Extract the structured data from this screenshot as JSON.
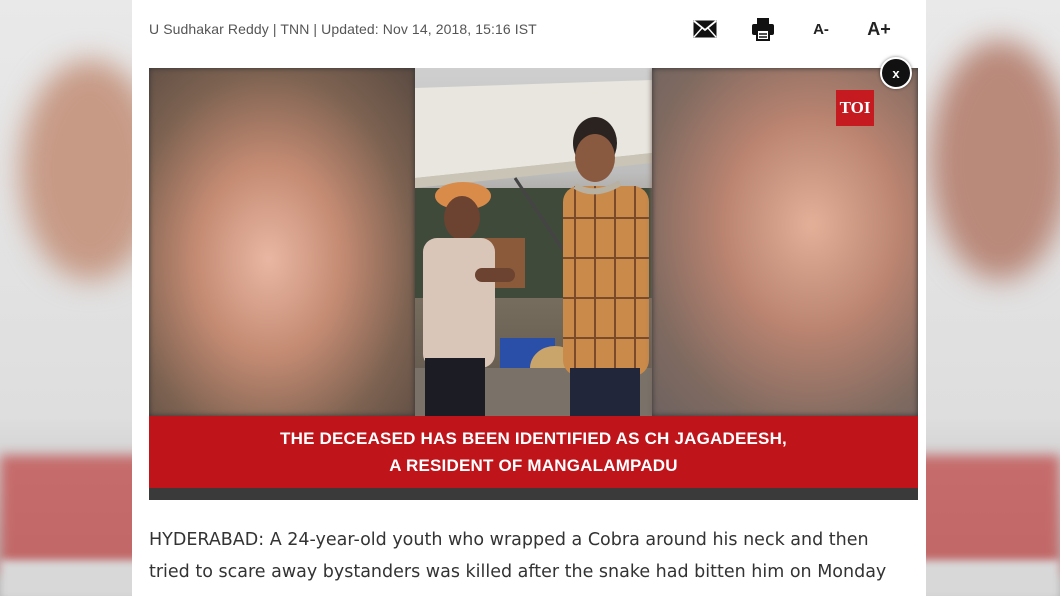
{
  "article": {
    "byline": "U Sudhakar Reddy | TNN | Updated: Nov 14, 2018, 15:16 IST",
    "tools": {
      "email_icon": "envelope-icon",
      "print_icon": "printer-icon",
      "font_smaller_label": "A-",
      "font_larger_label": "A+"
    },
    "video": {
      "logo_text": "TOI",
      "close_label": "x",
      "caption_line1": "THE DECEASED HAS BEEN IDENTIFIED AS CH JAGADEESH,",
      "caption_line2": "A RESIDENT OF MANGALAMPADU"
    },
    "body_line1": "HYDERABAD: A 24-year-old youth who wrapped a Cobra around his neck and then",
    "body_line2": "tried to scare away bystanders was killed after the snake had bitten him on Monday"
  },
  "colors": {
    "caption_bg": "#c0141b",
    "logo_bg": "#c41a20",
    "text": "#333333"
  }
}
